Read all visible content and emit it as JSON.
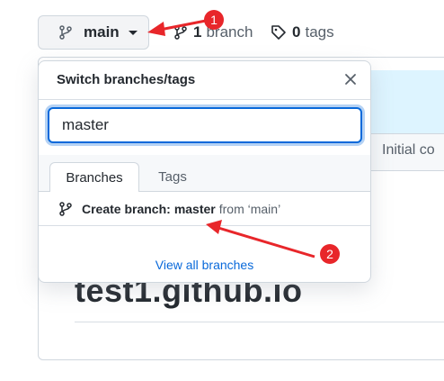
{
  "branch_button": {
    "label": "main",
    "icon": "git-branch-icon"
  },
  "branches_count": {
    "count": "1",
    "label": "branch"
  },
  "tags_count": {
    "count": "0",
    "label": "tags"
  },
  "background": {
    "commit_text": "Initial co",
    "repo_title": "test1.github.io"
  },
  "dropdown": {
    "title": "Switch branches/tags",
    "search_value": "master",
    "tabs": [
      {
        "label": "Branches",
        "active": true
      },
      {
        "label": "Tags",
        "active": false
      }
    ],
    "create": {
      "prefix": "Create branch:",
      "name": "master",
      "from_text": "from ‘main’"
    },
    "view_all": "View all branches"
  },
  "annotations": [
    {
      "number": "1"
    },
    {
      "number": "2"
    }
  ],
  "colors": {
    "accent": "#0969da",
    "annotation_red": "#e8262a"
  }
}
